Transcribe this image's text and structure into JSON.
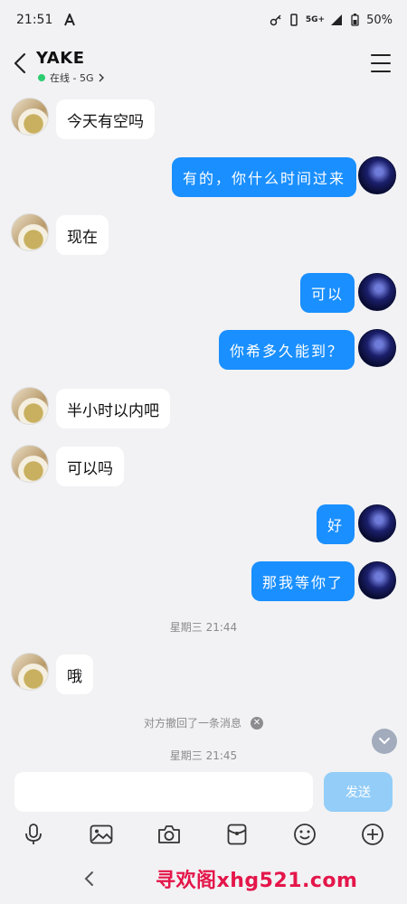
{
  "status_bar": {
    "time": "21:51",
    "signal": "5G+",
    "battery": "50%"
  },
  "header": {
    "title": "YAKE",
    "subtitle": "在线 - 5G"
  },
  "messages": [
    {
      "from": "other",
      "text": "今天有空吗"
    },
    {
      "from": "self",
      "text": "有的，你什么时间过来"
    },
    {
      "from": "other",
      "text": "现在"
    },
    {
      "from": "self",
      "text": "可以"
    },
    {
      "from": "self",
      "text": "你希多久能到？"
    },
    {
      "from": "other",
      "text": "半小时以内吧"
    },
    {
      "from": "other",
      "text": "可以吗"
    },
    {
      "from": "self",
      "text": "好"
    },
    {
      "from": "self",
      "text": "那我等你了"
    },
    {
      "from": "other",
      "text": "哦"
    }
  ],
  "timestamps": {
    "first": "星期三 21:44",
    "second": "星期三 21:45"
  },
  "recall_notice": "对方撤回了一条消息",
  "composer": {
    "placeholder": "",
    "send_label": "发送"
  },
  "toolbar_icons": [
    "microphone-icon",
    "image-icon",
    "camera-icon",
    "red-packet-icon",
    "emoji-icon",
    "plus-icon"
  ],
  "watermark": "寻欢阁xhg521.com",
  "colors": {
    "self_bubble": "#1a8fff",
    "other_bubble": "#ffffff",
    "background": "#f2f2f4",
    "send_button": "#93cdf8",
    "online": "#2ecc71",
    "watermark": "#e4164a"
  }
}
